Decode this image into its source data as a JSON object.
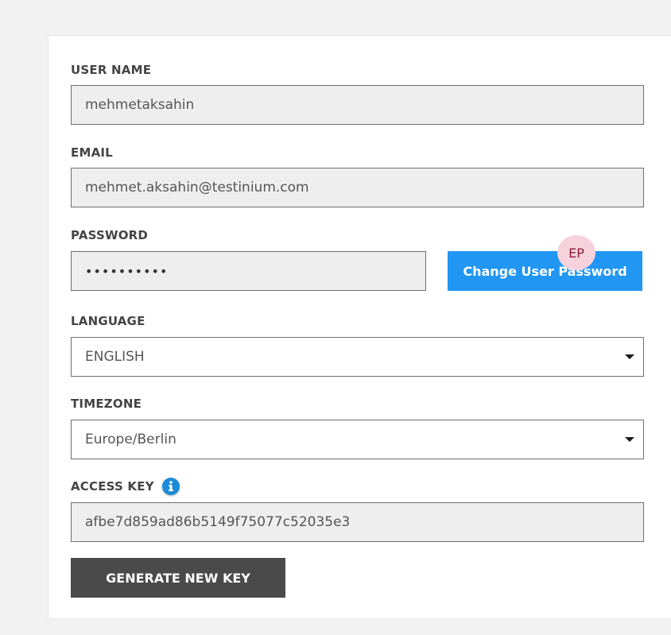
{
  "form": {
    "username": {
      "label": "USER NAME",
      "value": "mehmetaksahin"
    },
    "email": {
      "label": "EMAIL",
      "value": "mehmet.aksahin@testinium.com"
    },
    "password": {
      "label": "PASSWORD",
      "value": "••••••••••"
    },
    "change_password_label": "Change User Password",
    "language": {
      "label": "LANGUAGE",
      "selected": "ENGLISH"
    },
    "timezone": {
      "label": "TIMEZONE",
      "selected": "Europe/Berlin"
    },
    "access_key": {
      "label": "ACCESS KEY",
      "value": "afbe7d859ad86b5149f75077c52035e3",
      "info_icon": "i"
    },
    "generate_key_label": "GENERATE NEW KEY"
  },
  "avatar": {
    "initials": "EP"
  },
  "colors": {
    "primary_button": "#2196f3",
    "dark_button": "#4a4a4a",
    "info_icon": "#1a8bd8",
    "avatar_bg": "#f6d3dc",
    "avatar_text": "#8a1a3a"
  },
  "icons": {
    "info": "info-icon",
    "dropdown": "chevron-down-icon"
  }
}
